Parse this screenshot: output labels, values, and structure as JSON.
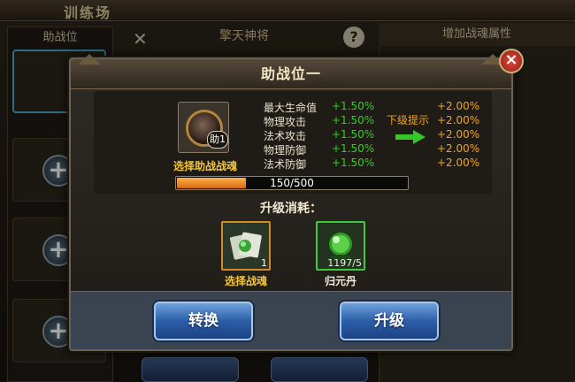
{
  "background": {
    "title": "训练场",
    "sidebar_header": "助战位",
    "hero_name": "擎天神将",
    "right_panel_header": "增加战魂属性",
    "colors": {
      "slot_selected": "#4aa6c8"
    }
  },
  "dialog": {
    "title": "助战位一",
    "close_icon": "×",
    "slot": {
      "badge": "助1",
      "caption": "选择助战战魂"
    },
    "next_level_hint": "下级提示",
    "stats": [
      {
        "name": "最大生命值",
        "current": "+1.50%",
        "next": "+2.00%"
      },
      {
        "name": "物理攻击",
        "current": "+1.50%",
        "next": "+2.00%"
      },
      {
        "name": "法术攻击",
        "current": "+1.50%",
        "next": "+2.00%"
      },
      {
        "name": "物理防御",
        "current": "+1.50%",
        "next": "+2.00%"
      },
      {
        "name": "法术防御",
        "current": "+1.50%",
        "next": "+2.00%"
      }
    ],
    "experience": {
      "text": "150/500",
      "current": 150,
      "max": 500
    },
    "cost_label": "升级消耗：",
    "items": [
      {
        "name": "选择战魂",
        "count": "1",
        "icon": "soul-cards-icon"
      },
      {
        "name": "归元丹",
        "count": "1197/5",
        "icon": "green-pill-icon"
      }
    ],
    "buttons": {
      "convert": "转换",
      "upgrade": "升级"
    },
    "colors": {
      "stat_current": "#2fd21b",
      "stat_next": "#f0a420",
      "caption": "#f0c542",
      "exp_fill": "#e07d1c",
      "button": "#2c5ea8"
    }
  }
}
